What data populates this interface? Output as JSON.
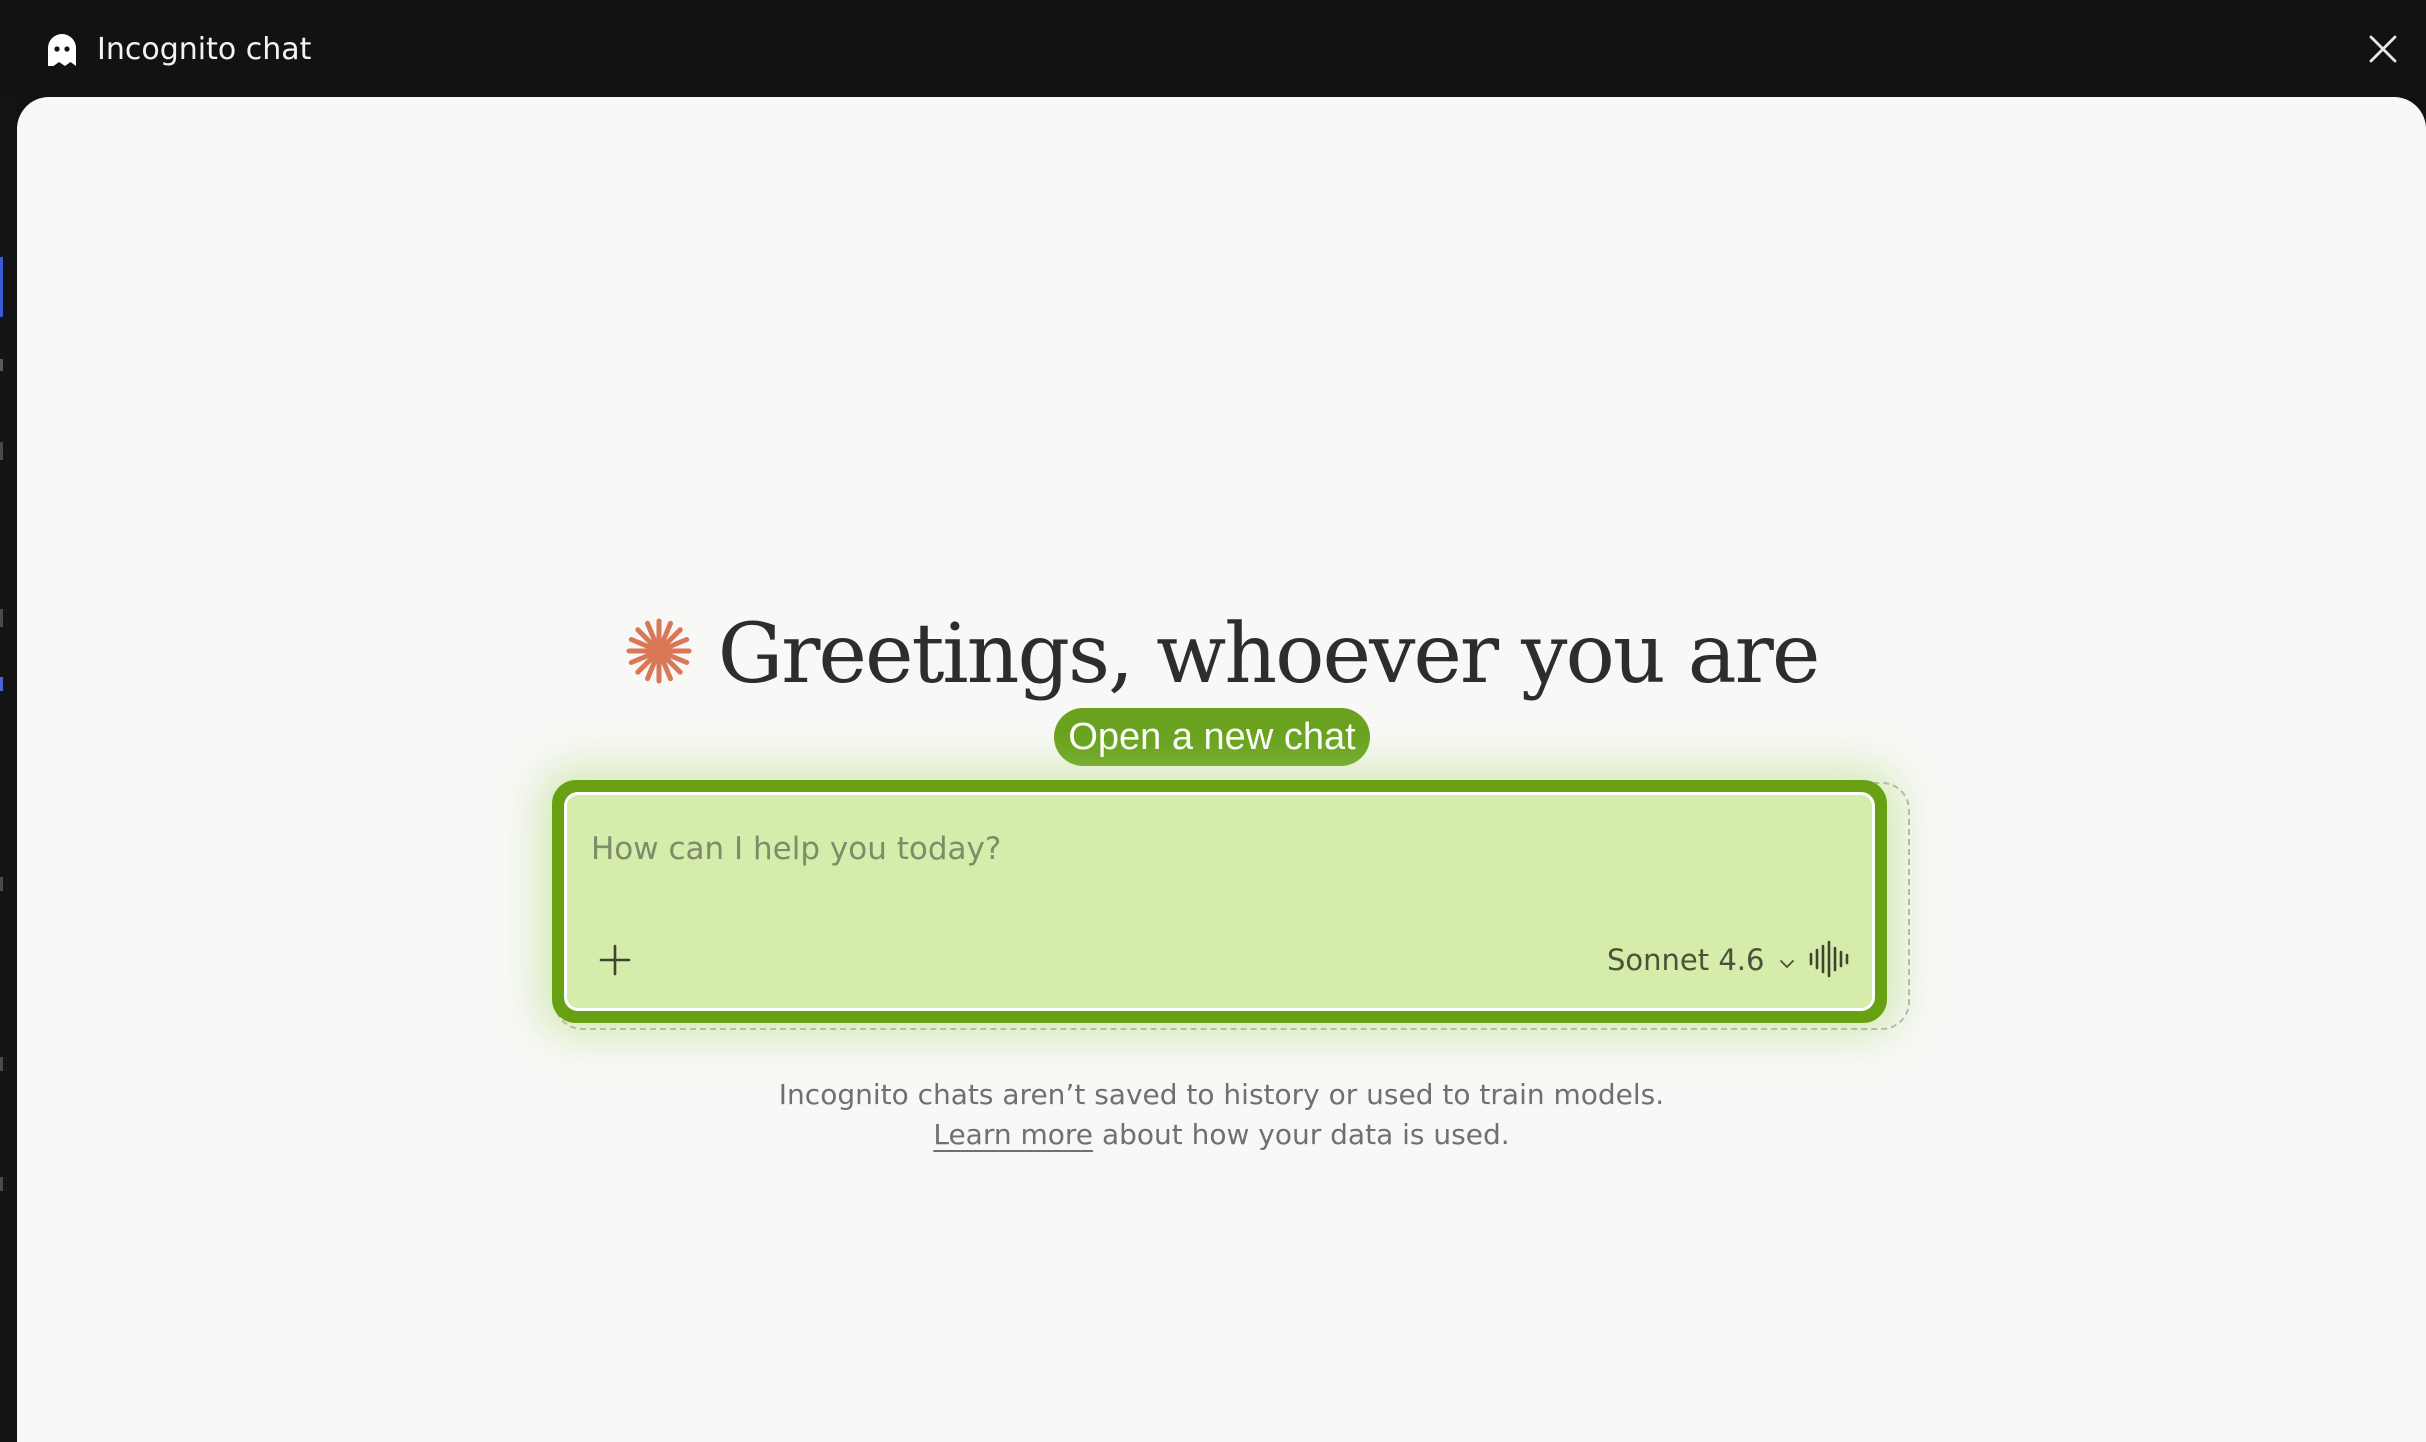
{
  "window": {
    "title": "Incognito chat",
    "icon": "ghost-icon",
    "close_icon": "close-icon"
  },
  "greeting": {
    "icon": "spark-icon",
    "icon_color": "#d97757",
    "text": "Greetings, whoever you are"
  },
  "new_chat_button": {
    "label": "Open a new chat",
    "color": "#6aa220"
  },
  "composer": {
    "placeholder": "How can I help you today?",
    "value": "",
    "attach_icon": "plus-icon",
    "model": "Sonnet 4.6",
    "model_icon": "chevron-down-icon",
    "voice_icon": "voice-waveform-icon",
    "highlight_color": "#67a013",
    "fill_color": "#d5ecab"
  },
  "notice": {
    "line1": "Incognito chats aren’t saved to history or used to train models.",
    "link_text": "Learn more",
    "line2_rest": "about how your data is used."
  }
}
